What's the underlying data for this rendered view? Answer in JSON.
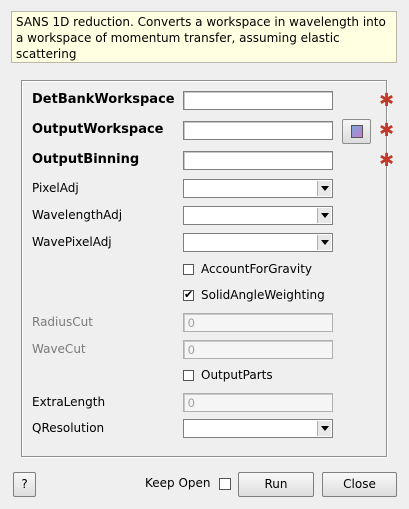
{
  "description": "SANS 1D reduction. Converts a workspace in wavelength into a workspace of momentum transfer, assuming elastic scattering",
  "properties": {
    "det_bank_workspace": {
      "label": "DetBankWorkspace",
      "value": ""
    },
    "output_workspace": {
      "label": "OutputWorkspace",
      "value": ""
    },
    "output_binning": {
      "label": "OutputBinning",
      "value": ""
    },
    "pixel_adj": {
      "label": "PixelAdj",
      "value": ""
    },
    "wavelength_adj": {
      "label": "WavelengthAdj",
      "value": ""
    },
    "wave_pixel_adj": {
      "label": "WavePixelAdj",
      "value": ""
    },
    "account_for_gravity": {
      "label": "AccountForGravity",
      "checked": false
    },
    "solid_angle_weighting": {
      "label": "SolidAngleWeighting",
      "checked": true
    },
    "radius_cut": {
      "label": "RadiusCut",
      "value": "0"
    },
    "wave_cut": {
      "label": "WaveCut",
      "value": "0"
    },
    "output_parts": {
      "label": "OutputParts",
      "checked": false
    },
    "extra_length": {
      "label": "ExtraLength",
      "value": "0"
    },
    "q_resolution": {
      "label": "QResolution",
      "value": ""
    }
  },
  "required_marker": "✱",
  "footer": {
    "help_label": "?",
    "keep_open_label": "Keep Open",
    "keep_open_checked": false,
    "run_label": "Run",
    "close_label": "Close"
  },
  "icons": {
    "browse": "workspace-browse-icon"
  },
  "colors": {
    "required": "#c0392b",
    "description_bg": "#ffffe1"
  }
}
